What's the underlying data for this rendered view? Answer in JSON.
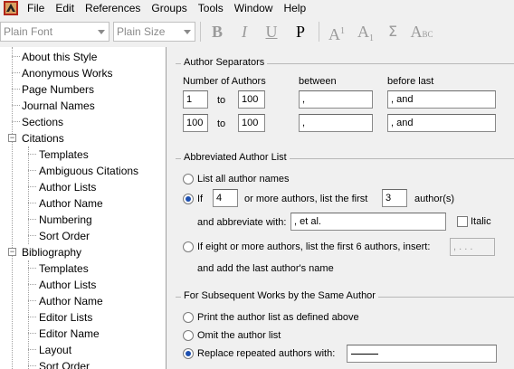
{
  "menu": [
    "File",
    "Edit",
    "References",
    "Groups",
    "Tools",
    "Window",
    "Help"
  ],
  "toolbar": {
    "font_select": "Plain Font",
    "size_select": "Plain Size",
    "bold": "B",
    "italic": "I",
    "underline": "U",
    "plain": "P",
    "superscript": "A",
    "superscript_mark": "1",
    "subscript": "A",
    "subscript_mark": "1",
    "sigma": "Σ",
    "smallcaps": "A",
    "smallcaps_mark": "BC"
  },
  "sidebar": {
    "items": [
      {
        "label": "About this Style"
      },
      {
        "label": "Anonymous Works"
      },
      {
        "label": "Page Numbers"
      },
      {
        "label": "Journal Names"
      },
      {
        "label": "Sections"
      },
      {
        "label": "Citations"
      },
      {
        "label": "Templates"
      },
      {
        "label": "Ambiguous Citations"
      },
      {
        "label": "Author Lists"
      },
      {
        "label": "Author Name"
      },
      {
        "label": "Numbering"
      },
      {
        "label": "Sort Order"
      },
      {
        "label": "Bibliography"
      },
      {
        "label": "Templates"
      },
      {
        "label": "Author Lists"
      },
      {
        "label": "Author Name"
      },
      {
        "label": "Editor Lists"
      },
      {
        "label": "Editor Name"
      },
      {
        "label": "Layout"
      },
      {
        "label": "Sort Order"
      }
    ],
    "expander_minus": "−"
  },
  "separators": {
    "title": "Author Separators",
    "col_number": "Number of Authors",
    "col_between": "between",
    "col_before_last": "before last",
    "to": "to",
    "rows": [
      {
        "from": "1",
        "to": "100",
        "between": ",",
        "before_last": ", and"
      },
      {
        "from": "100",
        "to": "100",
        "between": ",",
        "before_last": ", and"
      }
    ]
  },
  "abbreviated": {
    "title": "Abbreviated Author List",
    "list_all": "List all author names",
    "if_label": "If",
    "if_count": "4",
    "or_more": "or more authors, list the first",
    "first_count": "3",
    "authors_suffix": "author(s)",
    "abbreviate_with": "and abbreviate with:",
    "abbreviate_value": ", et al.",
    "italic": "Italic",
    "if_eight": "If eight or more authors, list the first 6 authors, insert:",
    "insert_value": ", . . .",
    "add_last": "and add the last author's name"
  },
  "subsequent": {
    "title": "For Subsequent Works by the Same Author",
    "print_list": "Print the author list as defined above",
    "omit_list": "Omit the author list",
    "replace": "Replace repeated authors with:"
  }
}
